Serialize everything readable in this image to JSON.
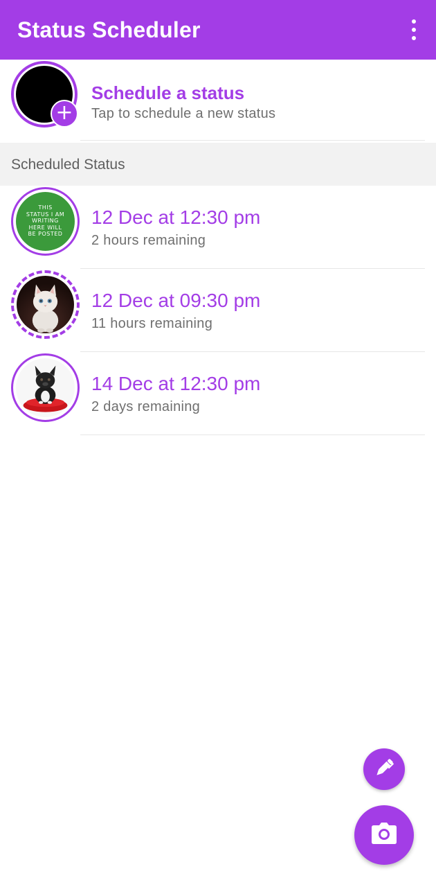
{
  "app_bar": {
    "title": "Status Scheduler",
    "menu_icon": "more-vert-icon",
    "background_color": "#a33de6"
  },
  "schedule_new": {
    "title": "Schedule a status",
    "subtitle": "Tap to schedule a new status",
    "badge_icon": "plus-icon"
  },
  "section": {
    "header": "Scheduled Status"
  },
  "statuses": [
    {
      "date": "12 Dec at 12:30 pm",
      "remaining": "2 hours remaining",
      "thumb_text": "THIS STATUS I AM WRITING HERE WILL BE POSTED"
    },
    {
      "date": "12 Dec at 09:30 pm",
      "remaining": "11 hours remaining",
      "thumb_image": "kitten-photo"
    },
    {
      "date": "14 Dec at 12:30 pm",
      "remaining": "2 days remaining",
      "thumb_image": "french-bulldog-photo"
    }
  ],
  "fabs": {
    "text_status_icon": "pen-icon",
    "camera_status_icon": "camera-icon"
  },
  "colors": {
    "accent": "#a33de6",
    "secondary_text": "#6f6f6f",
    "section_bg": "#f2f2f2"
  }
}
